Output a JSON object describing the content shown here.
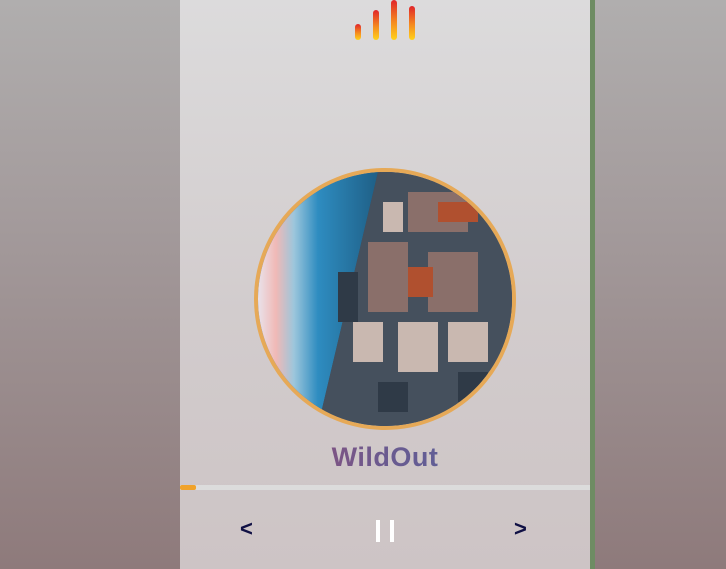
{
  "player": {
    "track_title": "WildOut",
    "progress": 0.04,
    "controls": {
      "prev": "<",
      "next": ">"
    },
    "equalizer_levels": [
      0.4,
      0.75,
      1.0,
      0.85
    ],
    "colors": {
      "accent": "#f0a22a",
      "album_border": "#e6a957",
      "control_text": "#101044",
      "pause_icon": "#ffffff"
    },
    "album_art": "city-skyline-image",
    "icons": [
      "equalizer-icon",
      "prev-icon",
      "pause-icon",
      "next-icon"
    ]
  }
}
